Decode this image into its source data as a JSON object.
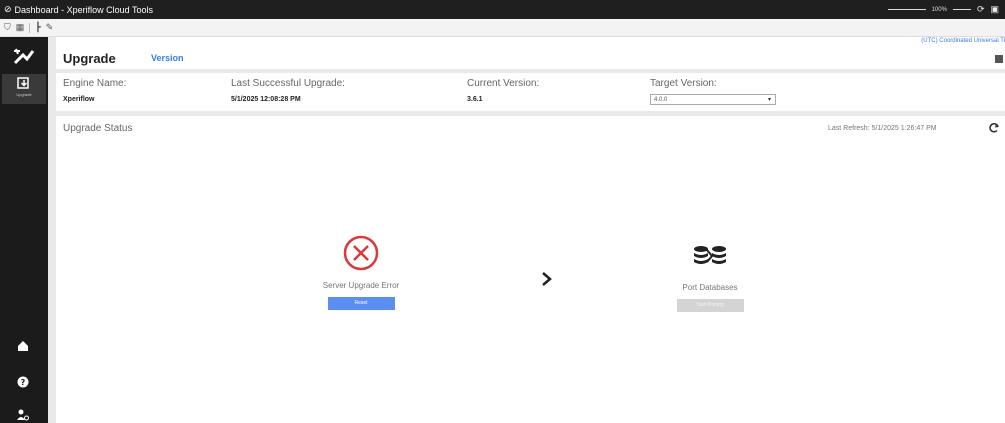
{
  "window": {
    "title": "Dashboard - Xperiflow Cloud Tools",
    "zoom": "100%"
  },
  "sidebar": {
    "items": [
      {
        "label": "Upgrade",
        "icon": "upgrade-icon",
        "active": true
      }
    ],
    "bottom_icons": [
      "home-icon",
      "help-icon",
      "users-settings-icon"
    ]
  },
  "header": {
    "title": "Upgrade",
    "tab": "Version",
    "timezone": "(UTC) Coordinated Universal Ti"
  },
  "info": {
    "engine_label": "Engine Name:",
    "engine_value": "Xperiflow",
    "last_upgrade_label": "Last Successful Upgrade:",
    "last_upgrade_value": "5/1/2025 12:08:28 PM",
    "current_version_label": "Current Version:",
    "current_version_value": "3.6.1",
    "target_version_label": "Target Version:",
    "target_version_value": "4.0.0"
  },
  "status": {
    "title": "Upgrade Status",
    "last_refresh": "Last Refresh: 5/1/2025 1:26:47 PM",
    "steps": [
      {
        "label": "Server Upgrade Error",
        "button": "Reset",
        "state": "error"
      },
      {
        "label": "Port Databases",
        "button": "Start Porting",
        "state": "disabled"
      }
    ]
  },
  "colors": {
    "accent": "#3b7de0",
    "error": "#d93a3a",
    "nav_bg": "#1b1b1b",
    "button_primary": "#5b8ef0"
  }
}
